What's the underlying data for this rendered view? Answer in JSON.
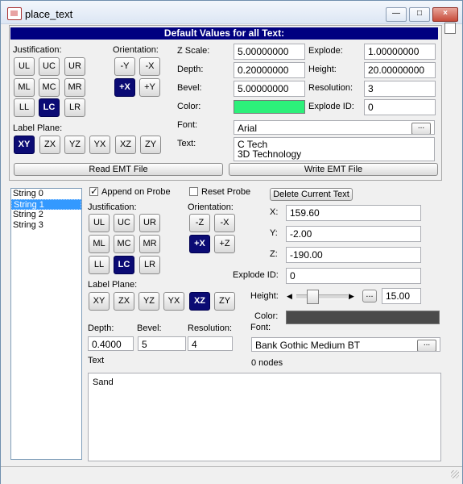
{
  "window": {
    "title": "place_text",
    "app_icon": "tech-icon",
    "minimize": "minimize-icon",
    "restore": "restore-icon",
    "close": "close-icon"
  },
  "defaults": {
    "header": "Default Values for all Text:",
    "justification_label": "Justification:",
    "justification": [
      "UL",
      "UC",
      "UR",
      "ML",
      "MC",
      "MR",
      "LL",
      "LC",
      "LR"
    ],
    "selected_justification": "LC",
    "orientation_label": "Orientation:",
    "orientation": [
      "-Y",
      "-X",
      "+X",
      "+Y"
    ],
    "selected_orientation": "+X",
    "label_plane_label": "Label Plane:",
    "label_planes": [
      "XY",
      "ZX",
      "YZ",
      "YX",
      "XZ",
      "ZY"
    ],
    "selected_plane": "XY",
    "z_scale_label": "Z Scale:",
    "z_scale": "5.00000000",
    "depth_label": "Depth:",
    "depth": "0.20000000",
    "bevel_label": "Bevel:",
    "bevel": "5.00000000",
    "color_label": "Color:",
    "color": "#2cf07a",
    "font_label": "Font:",
    "font": "Arial",
    "text_label": "Text:",
    "text_lines": [
      "C Tech",
      "3D Technology"
    ],
    "explode_label": "Explode:",
    "explode": "1.00000000",
    "height_label": "Height:",
    "height": "20.00000000",
    "resolution_label": "Resolution:",
    "resolution": "3",
    "explode_id_label": "Explode ID:",
    "explode_id": "0",
    "read_button": "Read EMT File",
    "write_button": "Write EMT File",
    "browse_button": "..."
  },
  "strings": {
    "items": [
      "String 0",
      "String 1",
      "String 2",
      "String 3"
    ],
    "selected": "String 1"
  },
  "current": {
    "append_label": "Append on Probe",
    "append_checked": true,
    "reset_label": "Reset Probe",
    "reset_checked": false,
    "delete_button": "Delete Current Text",
    "justification_label": "Justification:",
    "justification": [
      "UL",
      "UC",
      "UR",
      "ML",
      "MC",
      "MR",
      "LL",
      "LC",
      "LR"
    ],
    "selected_justification": "LC",
    "orientation_label": "Orientation:",
    "orientation": [
      "-Z",
      "-X",
      "+X",
      "+Z"
    ],
    "selected_orientation": "+X",
    "label_plane_label": "Label Plane:",
    "label_planes": [
      "XY",
      "ZX",
      "YZ",
      "YX",
      "XZ",
      "ZY"
    ],
    "selected_plane": "XZ",
    "x_label": "X:",
    "x": "159.60",
    "y_label": "Y:",
    "y": "-2.00",
    "z_label": "Z:",
    "z": "-190.00",
    "explode_id_label": "Explode ID:",
    "explode_id": "0",
    "height_label": "Height:",
    "height": "15.00",
    "height_slider_value": 0.2,
    "color_label": "Color:",
    "color": "#4a4a4a",
    "font_label": "Font:",
    "font": "Bank Gothic Medium BT",
    "nodes": "0 nodes",
    "depth_label": "Depth:",
    "depth": "0.4000",
    "bevel_label": "Bevel:",
    "bevel": "5",
    "resolution_label": "Resolution:",
    "resolution": "4",
    "text_label": "Text",
    "text": "Sand",
    "browse_button": "..."
  }
}
